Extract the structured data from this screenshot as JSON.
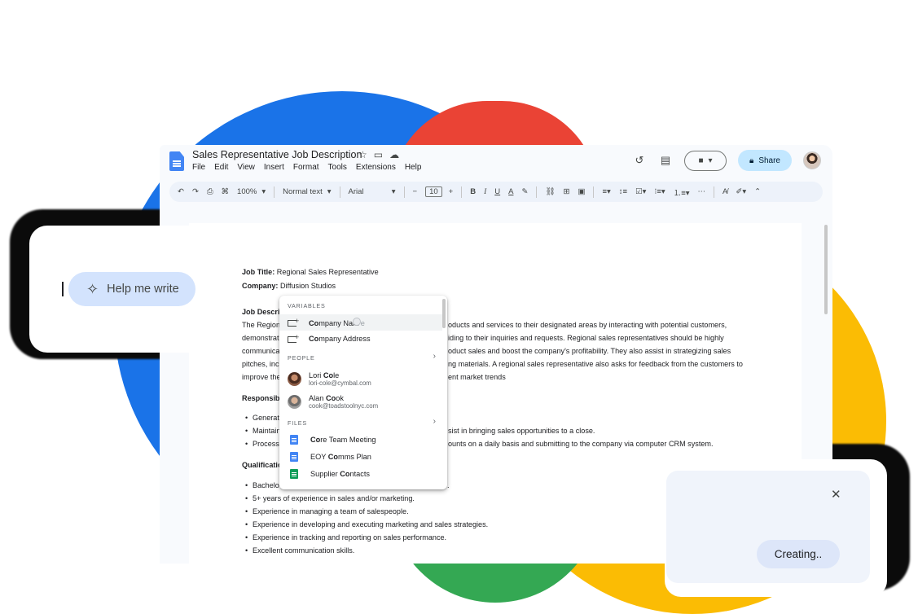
{
  "doc": {
    "title": "Sales Representative Job Description",
    "menu": [
      "File",
      "Edit",
      "View",
      "Insert",
      "Format",
      "Tools",
      "Extensions",
      "Help"
    ],
    "share_label": "Share"
  },
  "toolbar": {
    "zoom": "100%",
    "style": "Normal text",
    "font": "Arial",
    "font_size": "10"
  },
  "body": {
    "job_title_label": "Job Title:",
    "job_title_value": "Regional Sales Representative",
    "company_label": "Company:",
    "company_value": "Diffusion Studios",
    "job_desc_heading": "Job Descri",
    "para_lines": [
      "The Region",
      "demonstrat",
      "communica",
      "pitches, inc",
      "improve the"
    ],
    "para_tails": [
      "oducts and services to their designated areas by interacting with potential customers,",
      "iding to their inquiries and requests. Regional sales representatives should be highly",
      "oduct sales and boost the company's profitability. They also assist in strategizing sales",
      "ng materials. A regional sales representative also asks for feedback from the customers to",
      "ent market trends"
    ],
    "responsibilities_heading": "Responsib",
    "resp_items": [
      "Generat",
      "Maintain",
      "Process"
    ],
    "resp_tails": [
      "",
      "sist in bringing sales opportunities to a close.",
      "ounts on a daily basis and submitting to the company via computer CRM system."
    ],
    "qualifications_heading": "Qualificatio",
    "qual_items": [
      "Bachelo",
      "5+ years of experience in sales and/or marketing.",
      "Experience in managing a team of salespeople.",
      "Experience in developing and executing marketing and sales strategies.",
      "Experience in tracking and reporting on sales performance.",
      "Excellent communication skills."
    ],
    "qual_first_tail": "."
  },
  "popup": {
    "variables_label": "VARIABLES",
    "variables": [
      {
        "match": "Co",
        "rest": "mpany Nam",
        "tail": "e"
      },
      {
        "match": "Co",
        "rest": "mpany Address",
        "tail": ""
      }
    ],
    "people_label": "PEOPLE",
    "people": [
      {
        "pre": "Lori ",
        "match": "Co",
        "rest": "le",
        "email": "lori-cole@cymbal.com"
      },
      {
        "pre": "Alan ",
        "match": "Co",
        "rest": "ok",
        "email": "cook@toadstoolnyc.com"
      }
    ],
    "files_label": "FILES",
    "files": [
      {
        "pre": "",
        "match": "Co",
        "rest": "re Team Meeting",
        "type": "doc"
      },
      {
        "pre": "EOY ",
        "match": "Co",
        "rest": "mms Plan",
        "type": "doc"
      },
      {
        "pre": "Supplier ",
        "match": "Co",
        "rest": "ntacts",
        "type": "sheet"
      }
    ]
  },
  "help_card": {
    "label": "Help me write"
  },
  "create_card": {
    "label": "Creating.."
  },
  "icons": {
    "wand": "magic-wand-icon",
    "close": "close-icon",
    "history": "history-icon",
    "comment": "comment-icon",
    "meet": "video-call-icon",
    "lock": "lock-icon"
  },
  "colors": {
    "blue": "#1a73e8",
    "red": "#ea4335",
    "yellow": "#fbbc04",
    "green": "#34a853",
    "share_bg": "#c2e7ff",
    "help_bg": "#d3e3fd"
  }
}
